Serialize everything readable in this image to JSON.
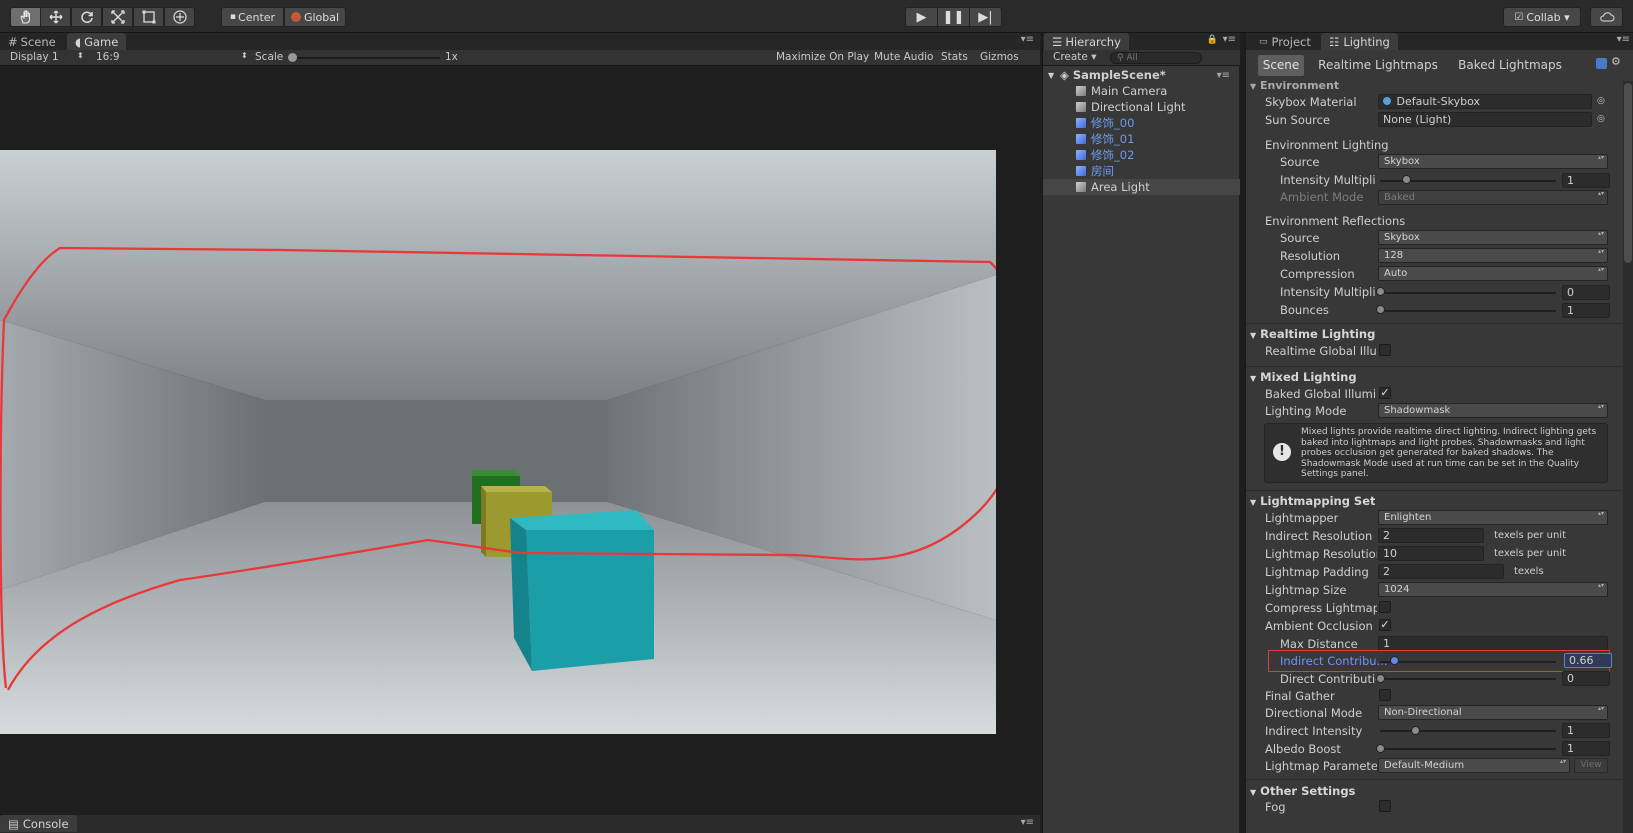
{
  "toolbar": {
    "tools": [
      "hand-tool-icon",
      "move-tool-icon",
      "rotate-tool-icon",
      "scale-tool-icon",
      "rect-tool-icon",
      "transform-tool-icon"
    ],
    "pivot_label": "Center",
    "space_label": "Global",
    "collab_label": "Collab ▾"
  },
  "scene_tabs": {
    "scene": "Scene",
    "game": "Game"
  },
  "game_bar": {
    "display": "Display 1",
    "aspect": "16:9",
    "scale_label": "Scale",
    "scale_value": "1x",
    "maximize": "Maximize On Play",
    "mute": "Mute Audio",
    "stats": "Stats",
    "gizmos": "Gizmos"
  },
  "console_tab": "Console",
  "hierarchy": {
    "tab": "Hierarchy",
    "create": "Create ▾",
    "search_placeholder": "All",
    "scene_name": "SampleScene*",
    "items": [
      {
        "label": "Main Camera",
        "prefab": false
      },
      {
        "label": "Directional Light",
        "prefab": false
      },
      {
        "label": "修饰_00",
        "prefab": true
      },
      {
        "label": "修饰_01",
        "prefab": true
      },
      {
        "label": "修饰_02",
        "prefab": true
      },
      {
        "label": "房间",
        "prefab": true
      },
      {
        "label": "Area Light",
        "prefab": false
      }
    ]
  },
  "lighting": {
    "tabs": {
      "project": "Project",
      "lighting": "Lighting"
    },
    "subtabs": [
      "Scene",
      "Realtime Lightmaps",
      "Baked Lightmaps"
    ],
    "environment": {
      "title": "Environment",
      "skybox_label": "Skybox Material",
      "skybox_value": "Default-Skybox",
      "sun_label": "Sun Source",
      "sun_value": "None (Light)",
      "env_lighting": "Environment Lighting",
      "source_label": "Source",
      "source_value": "Skybox",
      "intensity_label": "Intensity Multiplier",
      "intensity_value": "1",
      "ambient_label": "Ambient Mode",
      "ambient_value": "Baked",
      "env_reflections": "Environment Reflections",
      "refl_source_label": "Source",
      "refl_source_value": "Skybox",
      "resolution_label": "Resolution",
      "resolution_value": "128",
      "compression_label": "Compression",
      "compression_value": "Auto",
      "refl_intensity_label": "Intensity Multiplier",
      "refl_intensity_value": "0",
      "bounces_label": "Bounces",
      "bounces_value": "1"
    },
    "realtime": {
      "title": "Realtime Lighting",
      "gi_label": "Realtime Global Illumination"
    },
    "mixed": {
      "title": "Mixed Lighting",
      "baked_gi_label": "Baked Global Illumination",
      "mode_label": "Lighting Mode",
      "mode_value": "Shadowmask",
      "info": "Mixed lights provide realtime direct lighting. Indirect lighting gets baked into lightmaps and light probes. Shadowmasks and light probes occlusion get generated for baked shadows. The Shadowmask Mode used at run time can be set in the Quality Settings panel."
    },
    "lightmapping": {
      "title": "Lightmapping Settings",
      "lightmapper_label": "Lightmapper",
      "lightmapper_value": "Enlighten",
      "indirect_res_label": "Indirect Resolution",
      "indirect_res_value": "2",
      "lm_res_label": "Lightmap Resolution",
      "lm_res_value": "10",
      "texels_per_unit": "texels per unit",
      "padding_label": "Lightmap Padding",
      "padding_value": "2",
      "texels": "texels",
      "size_label": "Lightmap Size",
      "size_value": "1024",
      "compress_label": "Compress Lightmaps",
      "ao_label": "Ambient Occlusion",
      "max_distance_label": "Max Distance",
      "max_distance_value": "1",
      "indirect_contrib_label": "Indirect Contribu...",
      "indirect_contrib_value": "0.66",
      "direct_contrib_label": "Direct Contribution",
      "direct_contrib_value": "0",
      "final_gather_label": "Final Gather",
      "directional_label": "Directional Mode",
      "directional_value": "Non-Directional",
      "indirect_intensity_label": "Indirect Intensity",
      "indirect_intensity_value": "1",
      "albedo_label": "Albedo Boost",
      "albedo_value": "1",
      "params_label": "Lightmap Parameters",
      "params_value": "Default-Medium",
      "view_label": "View"
    },
    "other": {
      "title": "Other Settings",
      "fog_label": "Fog"
    }
  },
  "colors": {
    "annotation_red": "#e8383a",
    "cube_cyan": "#1ea8b3",
    "cube_yellow": "#a7a43a",
    "cube_green": "#2b7a2a",
    "accent_blue": "#5b7fd6"
  }
}
